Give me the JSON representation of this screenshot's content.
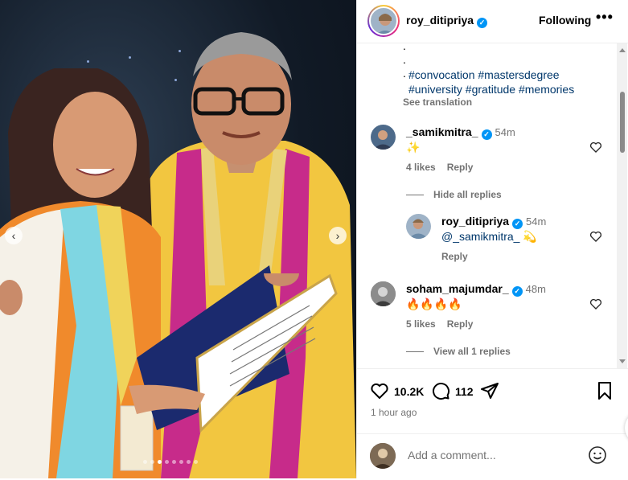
{
  "post": {
    "author": "roy_ditipriya",
    "follow_state": "Following",
    "more_label": "•••"
  },
  "caption": {
    "dots": [
      ".",
      ".",
      "."
    ],
    "hashtags": "#convocation #mastersdegree #university #gratitude #memories",
    "see_translation": "See translation"
  },
  "comments": [
    {
      "user": "_samikmitra_",
      "time": "54m",
      "text": "✨",
      "likes": "4 likes",
      "reply": "Reply",
      "replies_toggle": "Hide all replies"
    },
    {
      "user": "roy_ditipriya",
      "time": "54m",
      "mention": "@_samikmitra_",
      "text": "💫",
      "reply": "Reply"
    },
    {
      "user": "soham_majumdar_",
      "time": "48m",
      "text": "🔥🔥🔥🔥",
      "likes": "5 likes",
      "reply": "Reply",
      "replies_toggle": "View all 1 replies"
    }
  ],
  "actions": {
    "like_count": "10.2K",
    "comment_count": "112",
    "posted_ago": "1 hour ago"
  },
  "add_comment": {
    "placeholder": "Add a comment..."
  },
  "carousel": {
    "prev": "‹",
    "next": "›",
    "total": 8,
    "active": 2
  },
  "colors": {
    "link": "#00376b",
    "verified": "#0095f6",
    "muted": "#737373"
  }
}
